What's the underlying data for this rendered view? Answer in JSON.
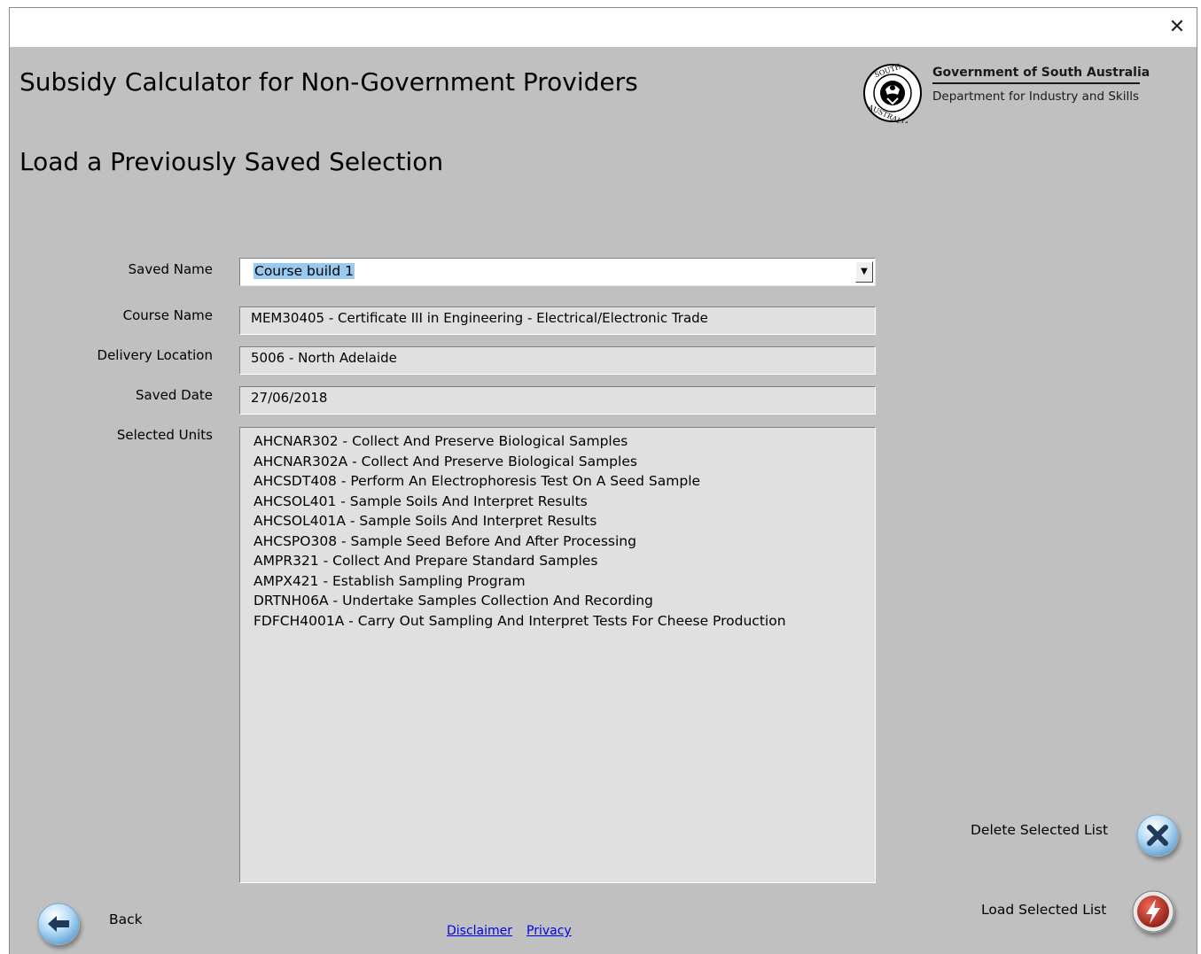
{
  "window": {
    "close_glyph": "✕"
  },
  "header": {
    "app_title": "Subsidy Calculator for Non-Government Providers",
    "page_title": "Load a Previously Saved Selection",
    "gov_name": "Government of South Australia",
    "dept_name": "Department for Industry and Skills",
    "logo_icon": "south-australia-seal-icon"
  },
  "form": {
    "saved_name_label": "Saved Name",
    "saved_name_value": "Course build 1",
    "course_name_label": "Course Name",
    "course_name_value": "MEM30405  -  Certificate III in Engineering - Electrical/Electronic Trade",
    "delivery_location_label": "Delivery Location",
    "delivery_location_value": "5006  -  North Adelaide",
    "saved_date_label": "Saved Date",
    "saved_date_value": "27/06/2018",
    "selected_units_label": "Selected Units",
    "selected_units": [
      "AHCNAR302  -  Collect And Preserve Biological Samples",
      "AHCNAR302A  -  Collect And Preserve Biological Samples",
      "AHCSDT408  -  Perform An Electrophoresis Test On A Seed Sample",
      "AHCSOL401  -  Sample Soils And Interpret Results",
      "AHCSOL401A  -  Sample Soils And Interpret Results",
      "AHCSPO308  -  Sample Seed Before And After Processing",
      "AMPR321  -  Collect And Prepare Standard Samples",
      "AMPX421  -  Establish Sampling Program",
      "DRTNH06A  -  Undertake Samples Collection And Recording",
      "FDFCH4001A  -  Carry Out Sampling And Interpret Tests For Cheese Production"
    ]
  },
  "actions": {
    "delete_label": "Delete Selected List",
    "load_label": "Load Selected List",
    "back_label": "Back"
  },
  "footer": {
    "disclaimer": "Disclaimer",
    "privacy": "Privacy"
  },
  "colors": {
    "background": "#c0c0c0",
    "field_bg": "#e0e0e0",
    "selection_highlight": "#99c9ef",
    "button_blue": "#a9d2f3",
    "load_button_red": "#c0392b"
  }
}
